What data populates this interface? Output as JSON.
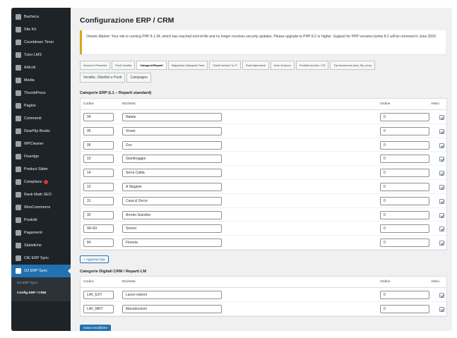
{
  "sidebar": {
    "items": [
      {
        "label": "Bacheca",
        "icon": "dashboard-icon"
      },
      {
        "label": "Site Kit",
        "icon": "sitekit-icon"
      },
      {
        "label": "Countdown Timer",
        "icon": "clock-icon"
      },
      {
        "label": "Tutor LMS",
        "icon": "tutor-icon"
      },
      {
        "label": "Articoli",
        "icon": "pin-icon"
      },
      {
        "label": "Media",
        "icon": "media-icon"
      },
      {
        "label": "ThumbPress",
        "icon": "thumbpress-icon"
      },
      {
        "label": "Pagine",
        "icon": "pages-icon"
      },
      {
        "label": "Commenti",
        "icon": "comments-icon"
      },
      {
        "label": "DearFlip Books",
        "icon": "book-icon"
      },
      {
        "label": "WPCleaner",
        "icon": "cleaner-icon"
      },
      {
        "label": "Fluentgo",
        "icon": "fluent-icon"
      },
      {
        "label": "Product Slider",
        "icon": "slider-icon"
      },
      {
        "label": "Complianz",
        "icon": "shield-icon",
        "badge": true
      },
      {
        "label": "Rank Math SEO",
        "icon": "chart-icon"
      },
      {
        "label": "WooCommerce",
        "icon": "woo-icon"
      },
      {
        "label": "Prodotti",
        "icon": "products-icon"
      },
      {
        "label": "Pagamenti",
        "icon": "payments-icon"
      },
      {
        "label": "Statistiche",
        "icon": "stats-icon"
      },
      {
        "label": "CIE ERP Sync",
        "icon": "sync-icon"
      },
      {
        "label": "O2 ERP Sync",
        "icon": "sync-icon",
        "active": true
      }
    ],
    "submenu": [
      {
        "label": "O2 ERP Sync"
      },
      {
        "label": "Config ERP / CRM",
        "current": true
      }
    ]
  },
  "page": {
    "title": "Configurazione ERP / CRM",
    "notice": "Onesto Market: Your site is running PHP 8.1.34, which has reached end-of-life and no longer receives security updates. Please upgrade to PHP 8.2 or higher. Support for PHP versions below 8.2 will be removed in June 2026.",
    "tabs_row1": [
      {
        "label": "Sezioni e Permessi"
      },
      {
        "label": "Punti Vendita"
      },
      {
        "label": "Categorie/Reparti",
        "active": true
      },
      {
        "label": "Mappatura Categorie Feed"
      },
      {
        "label": "Clienti esclusi / In IT"
      },
      {
        "label": "Ruoli dipendenti"
      },
      {
        "label": "Aree di lavoro"
      },
      {
        "label": "Prodotti servizio / CR"
      },
      {
        "label": "Tipi documento (sed_Sis_mov)"
      }
    ],
    "tabs_row2": [
      {
        "label": "Vendite, Obiettivi e Punti"
      },
      {
        "label": "Campagne"
      }
    ],
    "section1_title": "Categorie ERP (L1 – Reparti standard)",
    "section2_title": "Categorie Digitali CRM / Reparti LM",
    "columns": {
      "code": "Codice",
      "label": "Etichetta",
      "order": "Ordine",
      "active": "Attivo"
    },
    "add_button": "+ Aggiungi riga",
    "save_button": "Salva modifiche"
  },
  "rows_erp": [
    {
      "code": "04",
      "label": "Natale",
      "order": "0"
    },
    {
      "code": "05",
      "label": "Vivaio",
      "order": "0"
    },
    {
      "code": "06",
      "label": "Zoo",
      "order": "0"
    },
    {
      "code": "10",
      "label": "Giardinaggio",
      "order": "0"
    },
    {
      "code": "14",
      "label": "Serra Calda",
      "order": "0"
    },
    {
      "code": "15",
      "label": "A Stagioni",
      "order": "0"
    },
    {
      "code": "31",
      "label": "Casa & Decor",
      "order": "0"
    },
    {
      "code": "32",
      "label": "Arredo Giardino",
      "order": "0"
    },
    {
      "code": "90+93",
      "label": "Servizi",
      "order": "0"
    },
    {
      "code": "84",
      "label": "Fioreria",
      "order": "0"
    }
  ],
  "rows_crm": [
    {
      "code": "LAV_EXT",
      "label": "Lavori esterni",
      "order": "0"
    },
    {
      "code": "LAV_MNT",
      "label": "Manutenzioni",
      "order": "0"
    }
  ]
}
